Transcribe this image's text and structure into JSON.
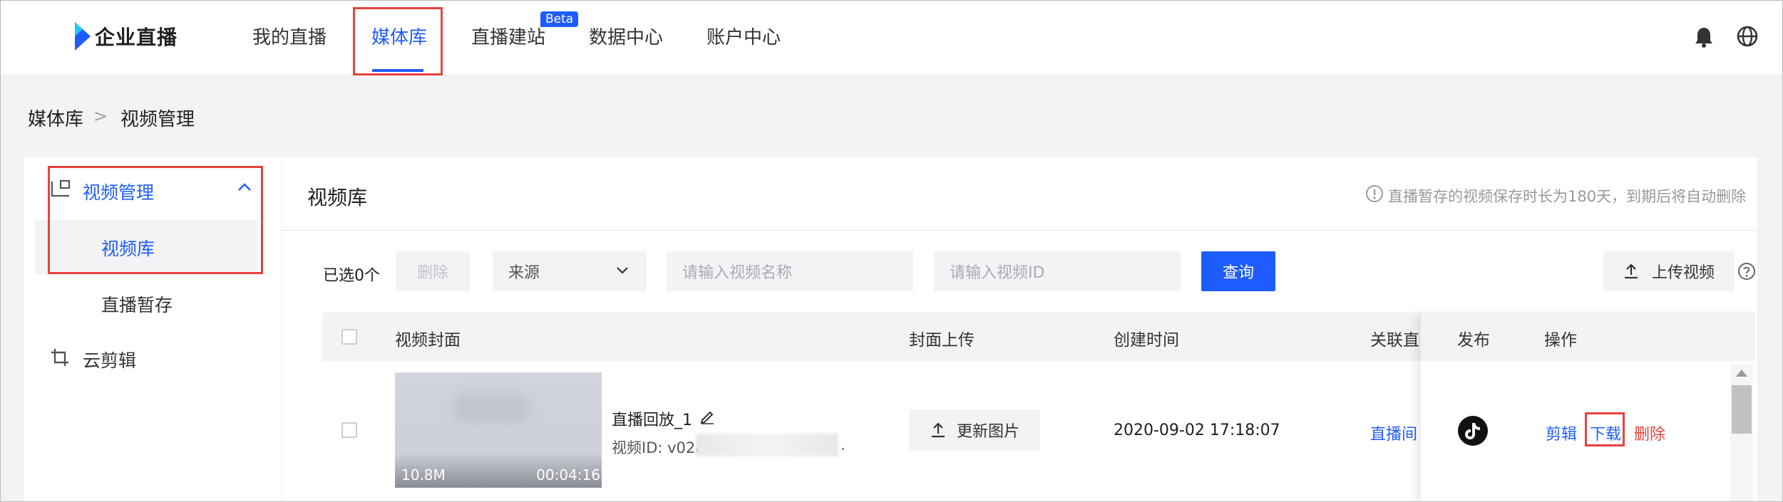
{
  "header": {
    "brand": "企业直播",
    "nav": [
      "我的直播",
      "媒体库",
      "直播建站",
      "数据中心",
      "账户中心"
    ],
    "beta_badge": "Beta",
    "icons": [
      "bell-icon",
      "globe-icon"
    ]
  },
  "breadcrumb": {
    "parent": "媒体库",
    "separator": ">",
    "current": "视频管理"
  },
  "sidebar": {
    "group_label": "视频管理",
    "items": [
      "视频库",
      "直播暂存"
    ],
    "other_group": "云剪辑"
  },
  "main": {
    "title": "视频库",
    "notice": "直播暂存的视频保存时长为180天，到期后将自动删除",
    "toolbar": {
      "selected_count": "已选0个",
      "delete_label": "删除",
      "source_select": "来源",
      "name_placeholder": "请输入视频名称",
      "id_placeholder": "请输入视频ID",
      "query_label": "查询",
      "upload_label": "上传视频"
    },
    "table": {
      "columns": [
        "视频封面",
        "封面上传",
        "创建时间",
        "关联直",
        "发布",
        "操作"
      ],
      "rows": [
        {
          "size": "10.8M",
          "duration": "00:04:16",
          "name": "直播回放_1",
          "video_id_prefix": "视频ID: v02a",
          "video_id_suffix": ".",
          "cover_action": "更新图片",
          "created": "2020-09-02 17:18:07",
          "related": "直播间",
          "actions": [
            "剪辑",
            "下载",
            "删除"
          ]
        }
      ]
    }
  },
  "colors": {
    "accent": "#1f5cff",
    "danger": "#e8413d",
    "annotation": "#e8413d"
  }
}
